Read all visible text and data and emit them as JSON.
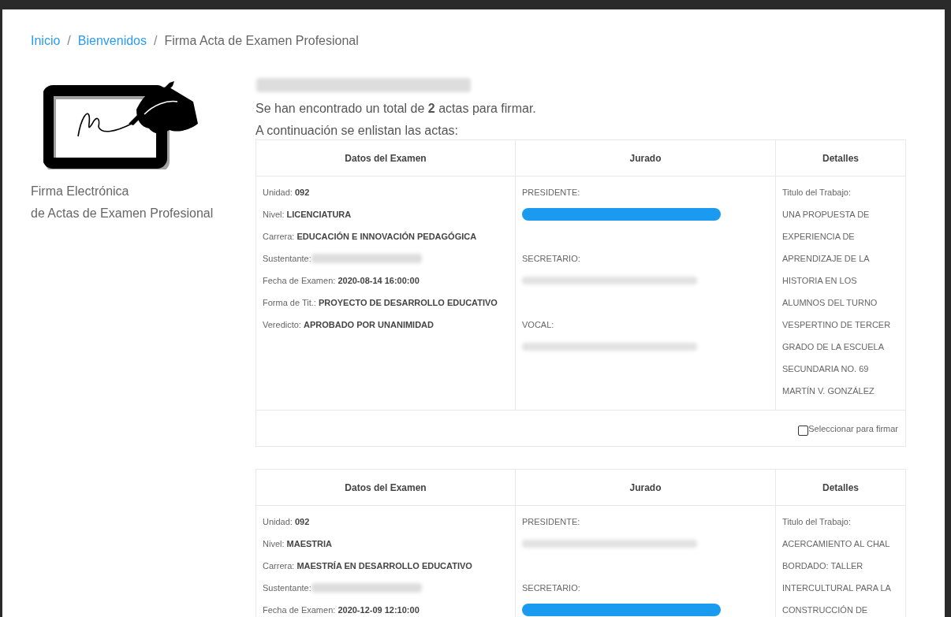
{
  "breadcrumb_separator": "/",
  "breadcrumb": [
    {
      "label": "Inicio",
      "link": true
    },
    {
      "label": "Bienvenidos",
      "link": true
    },
    {
      "label": "Firma Acta de Examen Profesional",
      "link": false
    }
  ],
  "sidebar": {
    "caption_lines": [
      "Firma Electrónica",
      "de Actas de Examen Profesional"
    ]
  },
  "summary": {
    "text": "Se han encontrado un total de **2** actas para firmar.",
    "subtitle": "A continuación se enlistan las actas:"
  },
  "actas": [
    {
      "columns": [
        "Datos del Examen",
        "Jurado",
        "Detalles"
      ],
      "fields": [
        {
          "label": "Unidad:",
          "value": "092",
          "kind": "text"
        },
        {
          "label": "Nivel:",
          "value": "LICENCIATURA",
          "kind": "text"
        },
        {
          "label": "Carrera:",
          "value": "EDUCACIÓN E INNOVACIÓN PEDAGÓGICA",
          "kind": "text"
        },
        {
          "label": "Sustentante:",
          "kind": "redacted"
        },
        {
          "label": "Fecha de Examen:",
          "value": "2020-08-14 16:00:00",
          "kind": "text"
        },
        {
          "label": "Forma de Tit.:",
          "value": "PROYECTO DE DESARROLLO EDUCATIVO",
          "kind": "text"
        },
        {
          "label": "Veredicto:",
          "value": "APROBADO POR UNANIMIDAD",
          "kind": "text"
        }
      ],
      "jurado": [
        {
          "role": "PRESIDENTE:",
          "highlighted": true
        },
        {
          "role": "SECRETARIO:",
          "highlighted": false
        },
        {
          "role": "VOCAL:",
          "highlighted": false
        }
      ],
      "details_label": "Titulo del Trabajo:",
      "title_lines": [
        "UNA PROPUESTA DE",
        "EXPERIENCIA DE",
        "APRENDIZAJE DE LA",
        "HISTORIA EN LOS",
        "ALUMNOS DEL TURNO",
        "VESPERTINO DE TERCER",
        "GRADO DE LA ESCUELA",
        "SECUNDARIA NO. 69",
        "MARTÍN V. GONZÁLEZ"
      ],
      "select": {
        "label": "Seleccionar para firmar",
        "checked": false
      }
    },
    {
      "columns": [
        "Datos del Examen",
        "Jurado",
        "Detalles"
      ],
      "fields": [
        {
          "label": "Unidad:",
          "value": "092",
          "kind": "text"
        },
        {
          "label": "Nivel:",
          "value": "MAESTRIA",
          "kind": "text"
        },
        {
          "label": "Carrera:",
          "value": "MAESTRÍA EN DESARROLLO EDUCATIVO",
          "kind": "text"
        },
        {
          "label": "Sustentante:",
          "kind": "redacted"
        },
        {
          "label": "Fecha de Examen:",
          "value": "2020-12-09 12:10:00",
          "kind": "text"
        }
      ],
      "jurado": [
        {
          "role": "PRESIDENTE:",
          "highlighted": false
        },
        {
          "role": "SECRETARIO:",
          "highlighted": true
        }
      ],
      "details_label": "Titulo del Trabajo:",
      "title_lines": [
        "ACERCAMIENTO AL CHAL",
        "BORDADO: TALLER",
        "INTERCULTURAL PARA LA",
        "CONSTRUCCIÓN DE"
      ]
    }
  ]
}
